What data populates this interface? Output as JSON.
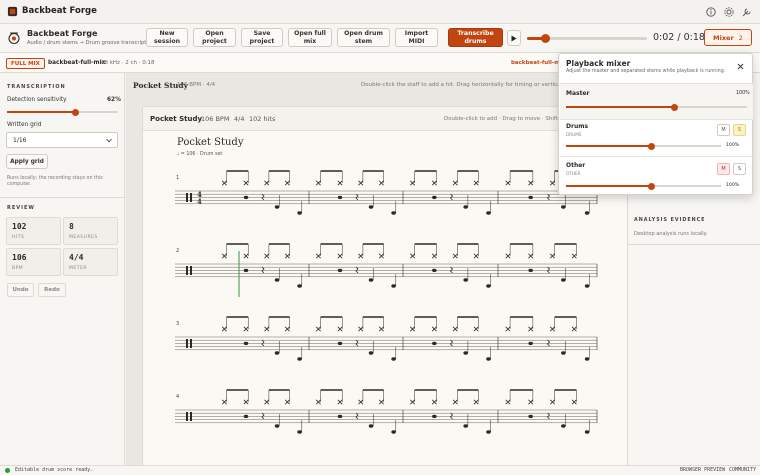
{
  "app": {
    "name": "Backbeat Forge"
  },
  "project": {
    "name": "Backbeat Forge",
    "subtitle": "Audio / drum stems → Drum groove transcription"
  },
  "toolbar": {
    "new_session": "New\nsession",
    "open_project": "Open\nproject",
    "save_project": "Save\nproject",
    "open_full_mix": "Open full\nmix",
    "open_drum_stem": "Open drum\nstem",
    "import_midi": "Import\nMIDI",
    "transcribe_drums": "Transcribe\ndrums"
  },
  "transport": {
    "time": "0:02 / 0:18",
    "progress": 0.15
  },
  "mixer_button": {
    "label": "Mixer",
    "badge": "2"
  },
  "subbar": {
    "chip": "FULL MIX",
    "file": "backbeat-full-mix",
    "meta": "48 kHz · 2 ch · 0:18",
    "right_file": "backbeat-full-mix"
  },
  "transcription": {
    "title": "TRANSCRIPTION",
    "sensitivity_label": "Detection sensitivity",
    "sensitivity_value": "62%",
    "sensitivity": 0.62,
    "grid_label": "Written grid",
    "grid_value": "1/16",
    "apply_label": "Apply grid",
    "note": "Runs locally; the recording stays on this computer."
  },
  "review": {
    "title": "REVIEW",
    "stats": [
      {
        "value": "102",
        "key": "HITS"
      },
      {
        "value": "8",
        "key": "MEASURES"
      },
      {
        "value": "106",
        "key": "BPM"
      },
      {
        "value": "4/4",
        "key": "METER"
      }
    ],
    "undo": "Undo",
    "redo": "Redo"
  },
  "score_header": {
    "title": "Pocket Study",
    "bpm": "106 BPM · 4/4",
    "hint": "Double-click the staff to add a hit. Drag horizontally for timing or vertically for lane."
  },
  "score_bar": {
    "title": "Pocket Study",
    "bpm": "106 BPM",
    "meter": "4/4",
    "hits": "102 hits",
    "hint": "Double-click to add · Drag to move · Shift/C"
  },
  "score": {
    "title": "Pocket Study",
    "tempo": "♩ = 106 · Drum set",
    "systems": [
      "1",
      "2",
      "3",
      "4"
    ]
  },
  "mixer": {
    "title": "Playback mixer",
    "subtitle": "Adjust the master and separated stems while playback is running.",
    "channels": [
      {
        "name": "Master",
        "sub": "",
        "value_label": "100%",
        "level": 0.6,
        "mute": "",
        "solo": ""
      },
      {
        "name": "Drums",
        "sub": "DRUMS",
        "value_label": "100%",
        "level": 0.55,
        "mute": "M",
        "solo": "S"
      },
      {
        "name": "Other",
        "sub": "OTHER",
        "value_label": "100%",
        "level": 0.55,
        "mute": "M",
        "solo": "S"
      }
    ]
  },
  "analysis": {
    "title": "ANALYSIS EVIDENCE",
    "text": "Desktop analysis runs locally."
  },
  "footer": {
    "status": "Editable drum score ready.",
    "preview": "BROWSER PREVIEW",
    "community": "COMMUNITY"
  },
  "colors": {
    "accent": "#c2450f",
    "ok": "#2f9a3b"
  }
}
